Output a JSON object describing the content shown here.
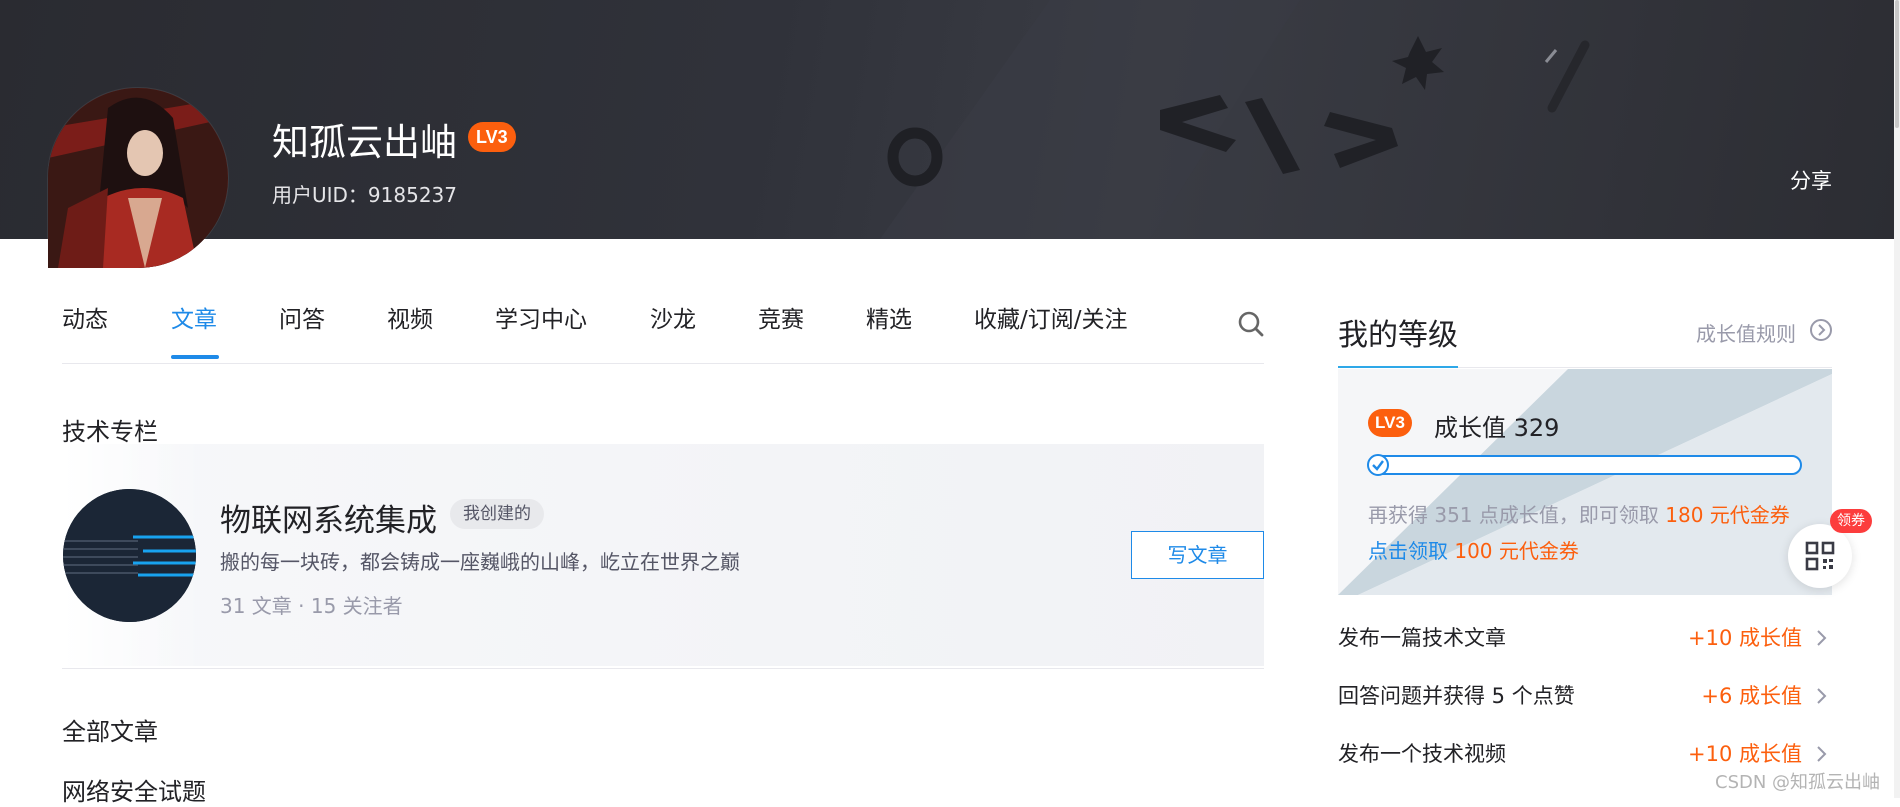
{
  "profile": {
    "username": "知孤云出岫",
    "level_badge": "LV3",
    "uid_text": "用户UID：9185237",
    "share_label": "分享"
  },
  "tabs": [
    {
      "label": "动态",
      "active": false
    },
    {
      "label": "文章",
      "active": true
    },
    {
      "label": "问答",
      "active": false
    },
    {
      "label": "视频",
      "active": false
    },
    {
      "label": "学习中心",
      "active": false
    },
    {
      "label": "沙龙",
      "active": false
    },
    {
      "label": "竞赛",
      "active": false
    },
    {
      "label": "精选",
      "active": false
    },
    {
      "label": "收藏/订阅/关注",
      "active": false
    }
  ],
  "tech_column": {
    "section_title": "技术专栏",
    "title": "物联网系统集成",
    "badge": "我创建的",
    "description": "搬的每一块砖，都会铸成一座巍峨的山峰，屹立在世界之巅",
    "meta": "31 文章 · 15 关注者",
    "write_button": "写文章"
  },
  "articles": {
    "section_title": "全部文章",
    "first_title": "网络安全试题"
  },
  "level_panel": {
    "title": "我的等级",
    "rules_link": "成长值规则",
    "badge": "LV3",
    "growth_text": "成长值 329",
    "progress_fraction": 0.02,
    "hint_prefix": "再获得 351 点成长值，即可领取",
    "hint_reward": "180 元代金券",
    "claim_link": "点击领取",
    "claim_reward": "100 元代金券",
    "tasks": [
      {
        "label": "发布一篇技术文章",
        "value": "+10 成长值"
      },
      {
        "label": "回答问题并获得 5 个点赞",
        "value": "+6 成长值"
      },
      {
        "label": "发布一个技术视频",
        "value": "+10 成长值"
      }
    ]
  },
  "float_widget": {
    "badge": "领券",
    "icon": "qrcode-icon"
  },
  "watermark": "CSDN @知孤云出岫",
  "colors": {
    "accent_blue": "#1e8ae8",
    "level_orange": "#fc5f0e",
    "banner_dark": "#2f3037",
    "coupon_red": "#fc3d3d"
  }
}
